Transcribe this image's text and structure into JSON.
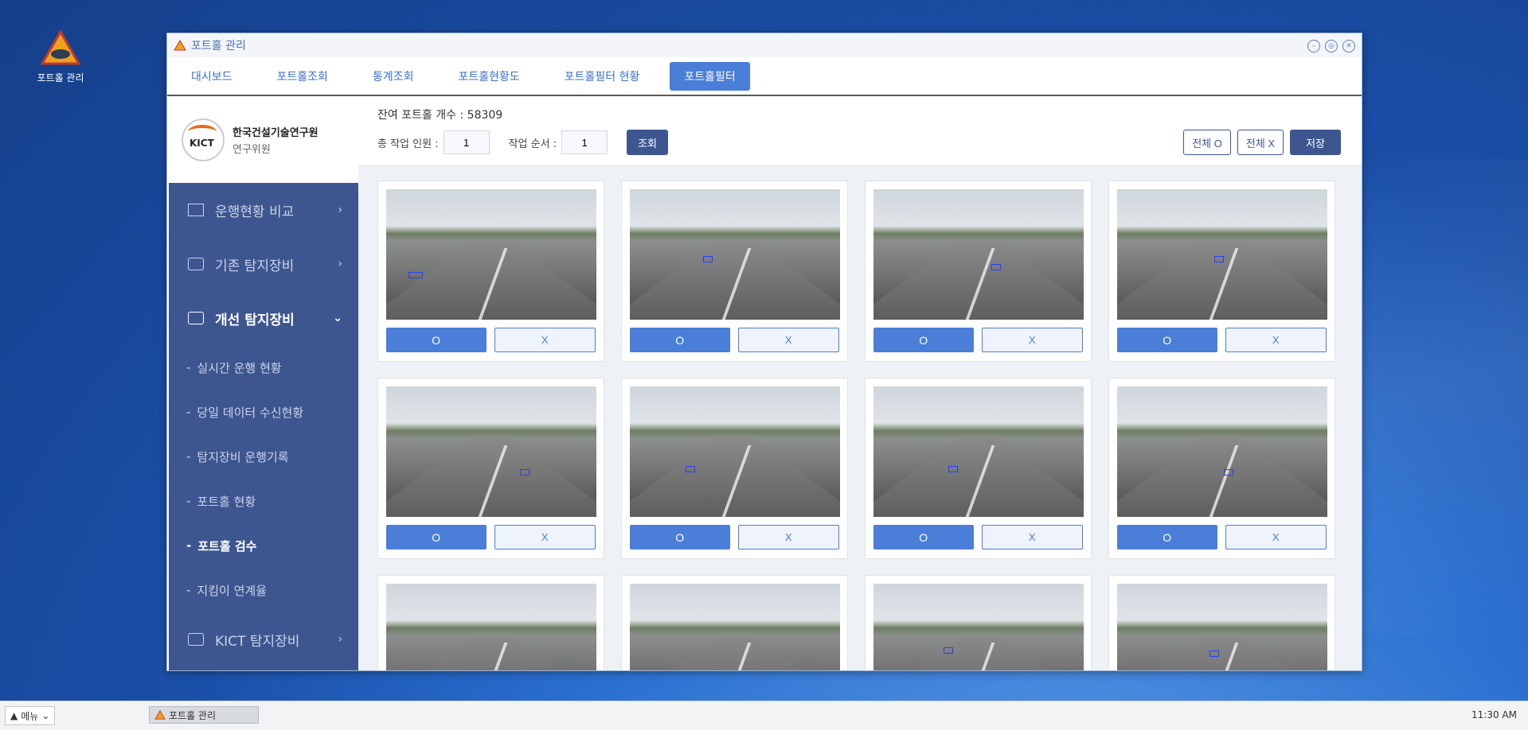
{
  "desktop": {
    "icon_label": "포트홀 관리"
  },
  "window": {
    "title": "포트홀 관리",
    "controls": [
      "minimize",
      "restore",
      "close"
    ]
  },
  "tabs": [
    {
      "label": "대시보드",
      "active": false
    },
    {
      "label": "포트홀조회",
      "active": false
    },
    {
      "label": "통계조회",
      "active": false
    },
    {
      "label": "포트홀현황도",
      "active": false
    },
    {
      "label": "포트홀필터 현황",
      "active": false
    },
    {
      "label": "포트홀필터",
      "active": true
    }
  ],
  "sidebar": {
    "logo_text": "KICT",
    "org": "한국건설기술연구원",
    "role": "연구위원",
    "items": [
      {
        "label": "운행현황 비교",
        "chevron": "›"
      },
      {
        "label": "기존 탐지장비",
        "chevron": "›"
      },
      {
        "label": "개선 탐지장비",
        "chevron": "⌄"
      },
      {
        "label": "KICT 탐지장비",
        "chevron": "›"
      }
    ],
    "subitems": [
      {
        "label": "실시간 운행 현황"
      },
      {
        "label": "당일 데이터 수신현황"
      },
      {
        "label": "탐지장비 운행기록"
      },
      {
        "label": "포트홀 현황"
      },
      {
        "label": "포트홀 검수"
      },
      {
        "label": "지킴이 연계율"
      }
    ]
  },
  "main": {
    "remaining_label": "잔여 포트홀 개수 : 58309",
    "workers_label": "총 작업 인원 :",
    "workers_value": "1",
    "order_label": "작업 순서 :",
    "order_value": "1",
    "search_button": "조회",
    "all_o_button": "전체 O",
    "all_x_button": "전체 X",
    "save_button": "저장",
    "o_label": "O",
    "x_label": "X"
  },
  "taskbar": {
    "menu_label": "메뉴",
    "task_label": "포트홀 관리",
    "clock": "11:30 AM"
  },
  "colors": {
    "primary": "#4a7ed9",
    "sidebar": "#3e5690",
    "dark_button": "#3e5690"
  }
}
